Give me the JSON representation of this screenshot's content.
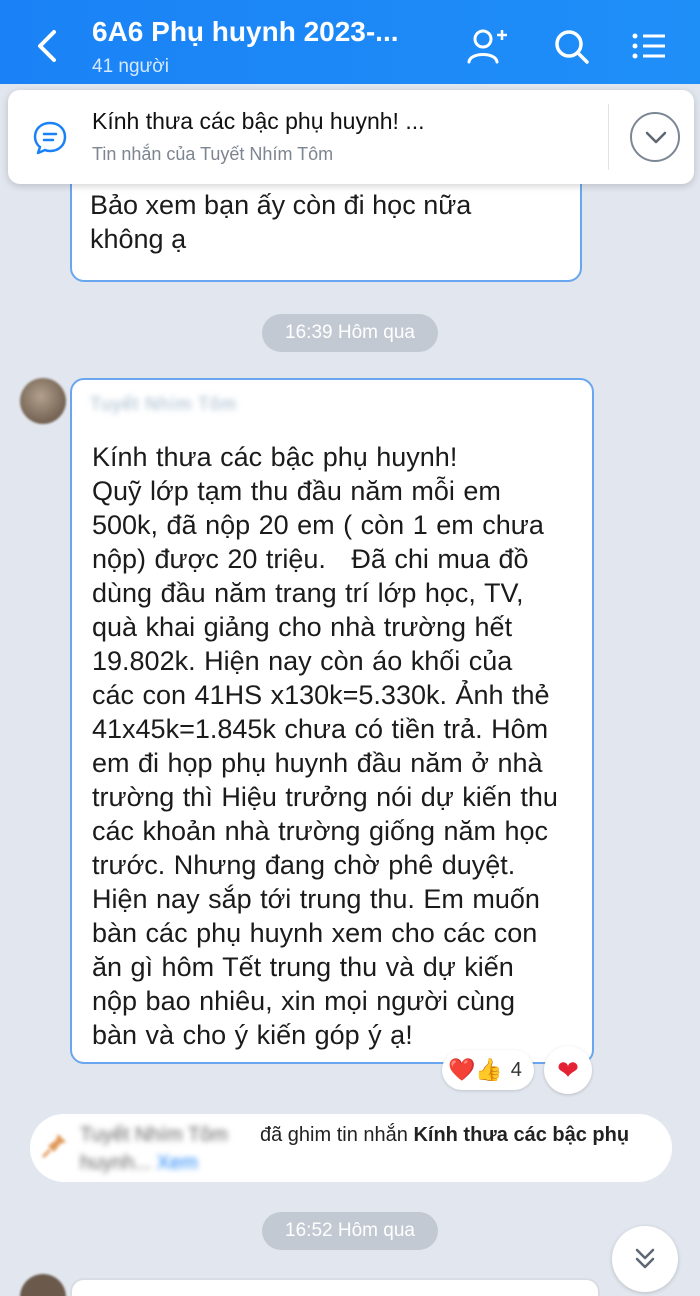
{
  "header": {
    "title": "6A6 Phụ huynh 2023-...",
    "member_count": "41 người",
    "back_icon": "back-arrow",
    "add_member_icon": "add-person-icon",
    "search_icon": "search-icon",
    "menu_icon": "list-menu-icon",
    "color": "#1a82f6"
  },
  "pinned": {
    "title": "Kính thưa các bậc phụ huynh! ...",
    "subtitle": "Tin nhắn của Tuyết  Nhím  Tôm"
  },
  "previous_message": {
    "text": "Bảo xem bạn ấy còn đi học nữa\nkhông ạ"
  },
  "time_separators": [
    "16:39 Hôm qua",
    "16:52 Hôm qua"
  ],
  "message": {
    "sender": "Tuyết Nhím Tôm",
    "text": "Kính thưa các bậc phụ huynh!\nQuỹ lớp tạm thu đầu năm mỗi em\n500k, đã nộp 20 em ( còn 1 em chưa\nnộp) được 20 triệu.   Đã chi mua đồ\ndùng đầu năm trang trí lớp học, TV,\nquà khai giảng cho nhà trường hết\n19.802k. Hiện nay còn áo khối của\ncác con 41HS x130k=5.330k. Ảnh thẻ\n41x45k=1.845k chưa có tiền trả. Hôm\nem đi họp phụ huynh đầu năm ở nhà\ntrường thì Hiệu trưởng nói dự kiến thu\ncác khoản nhà trường giống năm học\ntrước. Nhưng đang chờ phê duyệt.\nHiện nay sắp tới trung thu. Em muốn\nbàn các phụ huynh xem cho các con\năn gì hôm Tết trung thu và dự kiến\nnộp bao nhiêu, xin mọi người cùng\nbàn và cho ý kiến góp ý ạ!",
    "reactions": {
      "emoji": "❤️👍",
      "count": "4"
    },
    "react_button": "❤"
  },
  "pin_notice": {
    "actor": "Tuyết  Nhím  Tôm",
    "action": "đã ghim tin nhắn ",
    "target": "Kính thưa các bậc phụ",
    "continuation": "huynh... ",
    "link": "Xem"
  }
}
